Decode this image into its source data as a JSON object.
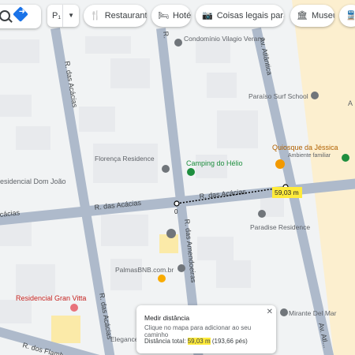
{
  "toolbar": {
    "select_value": "P₁",
    "chips": [
      {
        "icon": "fork-knife-icon",
        "glyph": "🍴",
        "label": "Restaurantes"
      },
      {
        "icon": "bed-icon",
        "glyph": "🛏",
        "label": "Hotéis"
      },
      {
        "icon": "camera-icon",
        "glyph": "📷",
        "label": "Coisas legais para faz..."
      },
      {
        "icon": "museum-icon",
        "glyph": "🏛",
        "label": "Museus"
      },
      {
        "icon": "transit-icon",
        "glyph": "🚆",
        "label": ""
      }
    ]
  },
  "streets": {
    "acacias_h": "R. das Acácias",
    "acacias_h2": "R. das Acácias",
    "acacias_left": "cácias",
    "acacias_v1": "R. das Acácias",
    "acacias_v2": "R. das Acácias",
    "amendoeiras": "R. das Amendoeiras",
    "atlantica_top": "Av. Atlântica",
    "atlantica_bottom": "Av. Atl...",
    "flamb": "R. dos Flamb..."
  },
  "places": {
    "condominio": "Condomínio Vilagio Verano",
    "paraiso": "Paraíso Surf School",
    "florenca": "Florença Residence",
    "camping": "Camping do Hélio",
    "quiosque": "Quiosque da Jéssica",
    "quiosque_sub": "Ambiente familiar",
    "dom_joao": "esidencial Dom João",
    "paradise": "Paradise Residence",
    "palmas": "PalmasBNB.com.br",
    "gran_vitta": "Residencial Gran Vitta",
    "mirante": "Mirante Del Mar",
    "elegance": "Elegance",
    "edge_a": "A"
  },
  "measure": {
    "start_label": "0",
    "end_label": "59,03 m"
  },
  "popup": {
    "title": "Medir distância",
    "hint": "Clique no mapa para adicionar ao seu caminho",
    "total_prefix": "Distância total: ",
    "total_m": "59,03 m",
    "total_ft": " (193,66 pés)",
    "close": "✕"
  },
  "colors": {
    "road": "#aebacb",
    "road_edge": "#9aa8bb",
    "block": "#e8eaed",
    "beach": "#fcefcf",
    "park": "#c9e8d2",
    "teal_pin": "#1e8e3e",
    "orange_pin": "#f29900",
    "pink_pin": "#e8727b",
    "gray_pin": "#70757a"
  }
}
